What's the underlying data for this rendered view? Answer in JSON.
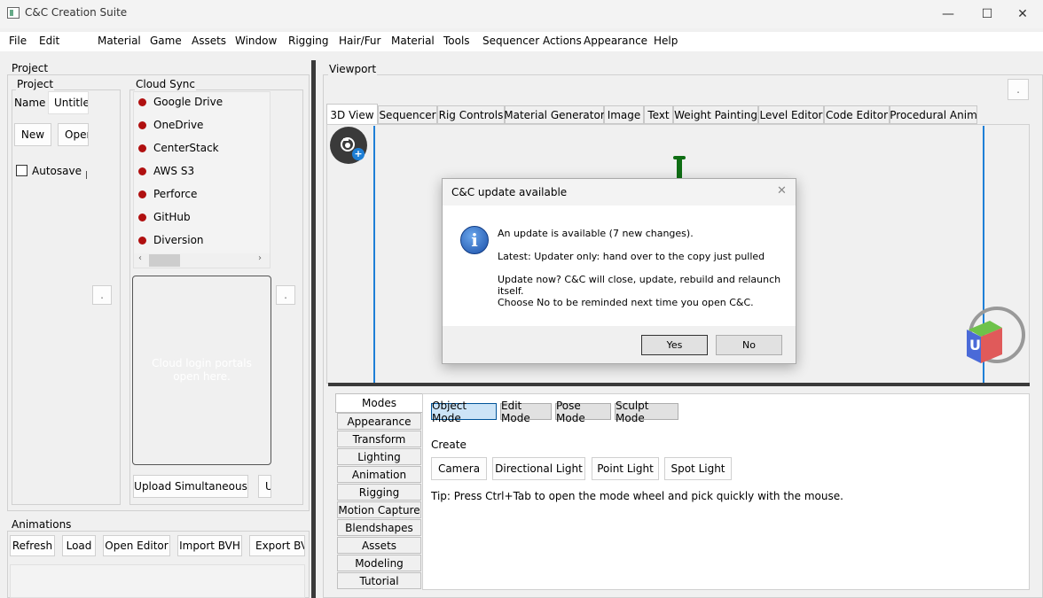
{
  "window": {
    "title": "C&C Creation Suite",
    "controls": {
      "minimize": "—",
      "maximize": "☐",
      "close": "✕"
    }
  },
  "menu": [
    "File",
    "Edit",
    "Material",
    "Game",
    "Assets",
    "Window",
    "Rigging",
    "Hair/Fur",
    "Material",
    "Tools",
    "Sequencer Actions",
    "Appearance",
    "Help"
  ],
  "project_panel": {
    "title": "Project",
    "project_group": {
      "title": "Project",
      "name_label": "Name",
      "name_value": "Untitled",
      "new_button": "New",
      "open_button": "Open",
      "autosave_label": "Autosave",
      "small_button": "."
    },
    "cloud_group": {
      "title": "Cloud Sync",
      "items": [
        "Google Drive",
        "OneDrive",
        "CenterStack",
        "AWS S3",
        "Perforce",
        "GitHub",
        "Diversion"
      ],
      "status_color": "#b01010",
      "login_placeholder": "Cloud login portals open here.",
      "upload_button": "Upload Simultaneous",
      "u_button": "U",
      "small_button": "."
    }
  },
  "animations_panel": {
    "title": "Animations",
    "buttons": [
      "Refresh",
      "Load",
      "Open Editor",
      "Import BVH",
      "Export BVH"
    ]
  },
  "viewport": {
    "title": "Viewport",
    "corner_button": ".",
    "tabs": [
      "3D View",
      "Sequencer",
      "Rig Controls",
      "Material Generator",
      "Image",
      "Text",
      "Weight Painting",
      "Level Editor",
      "Code Editor",
      "Procedural Anim"
    ],
    "active_tab": "3D View",
    "gizmo_label": "U",
    "camera_add": "+"
  },
  "bottom_panel": {
    "side_tabs": [
      "Modes",
      "Appearance",
      "Transform",
      "Lighting",
      "Animation",
      "Rigging",
      "Motion Capture",
      "Blendshapes",
      "Assets",
      "Modeling",
      "Tutorial"
    ],
    "active_side_tab": "Modes",
    "modes": [
      "Object Mode",
      "Edit Mode",
      "Pose Mode",
      "Sculpt Mode"
    ],
    "active_mode": "Object Mode",
    "create_label": "Create",
    "create_buttons": [
      "Camera",
      "Directional Light",
      "Point Light",
      "Spot Light"
    ],
    "tip": "Tip: Press Ctrl+Tab to open the mode wheel and pick quickly with the mouse."
  },
  "dialog": {
    "title": "C&C update available",
    "line1": "An update is available (7 new changes).",
    "line2": "Latest: Updater only: hand over to the copy just pulled",
    "line3": "Update now? C&C will close, update, rebuild and relaunch",
    "line4": "itself.",
    "line5": "Choose No to be reminded next time you open C&C.",
    "yes": "Yes",
    "no": "No",
    "close": "✕",
    "info_icon_glyph": "i"
  },
  "colors": {
    "accent_blue": "#1e7fd6",
    "splitter": "#3a3a3a",
    "selected_mode_bg": "#cce4f7"
  }
}
